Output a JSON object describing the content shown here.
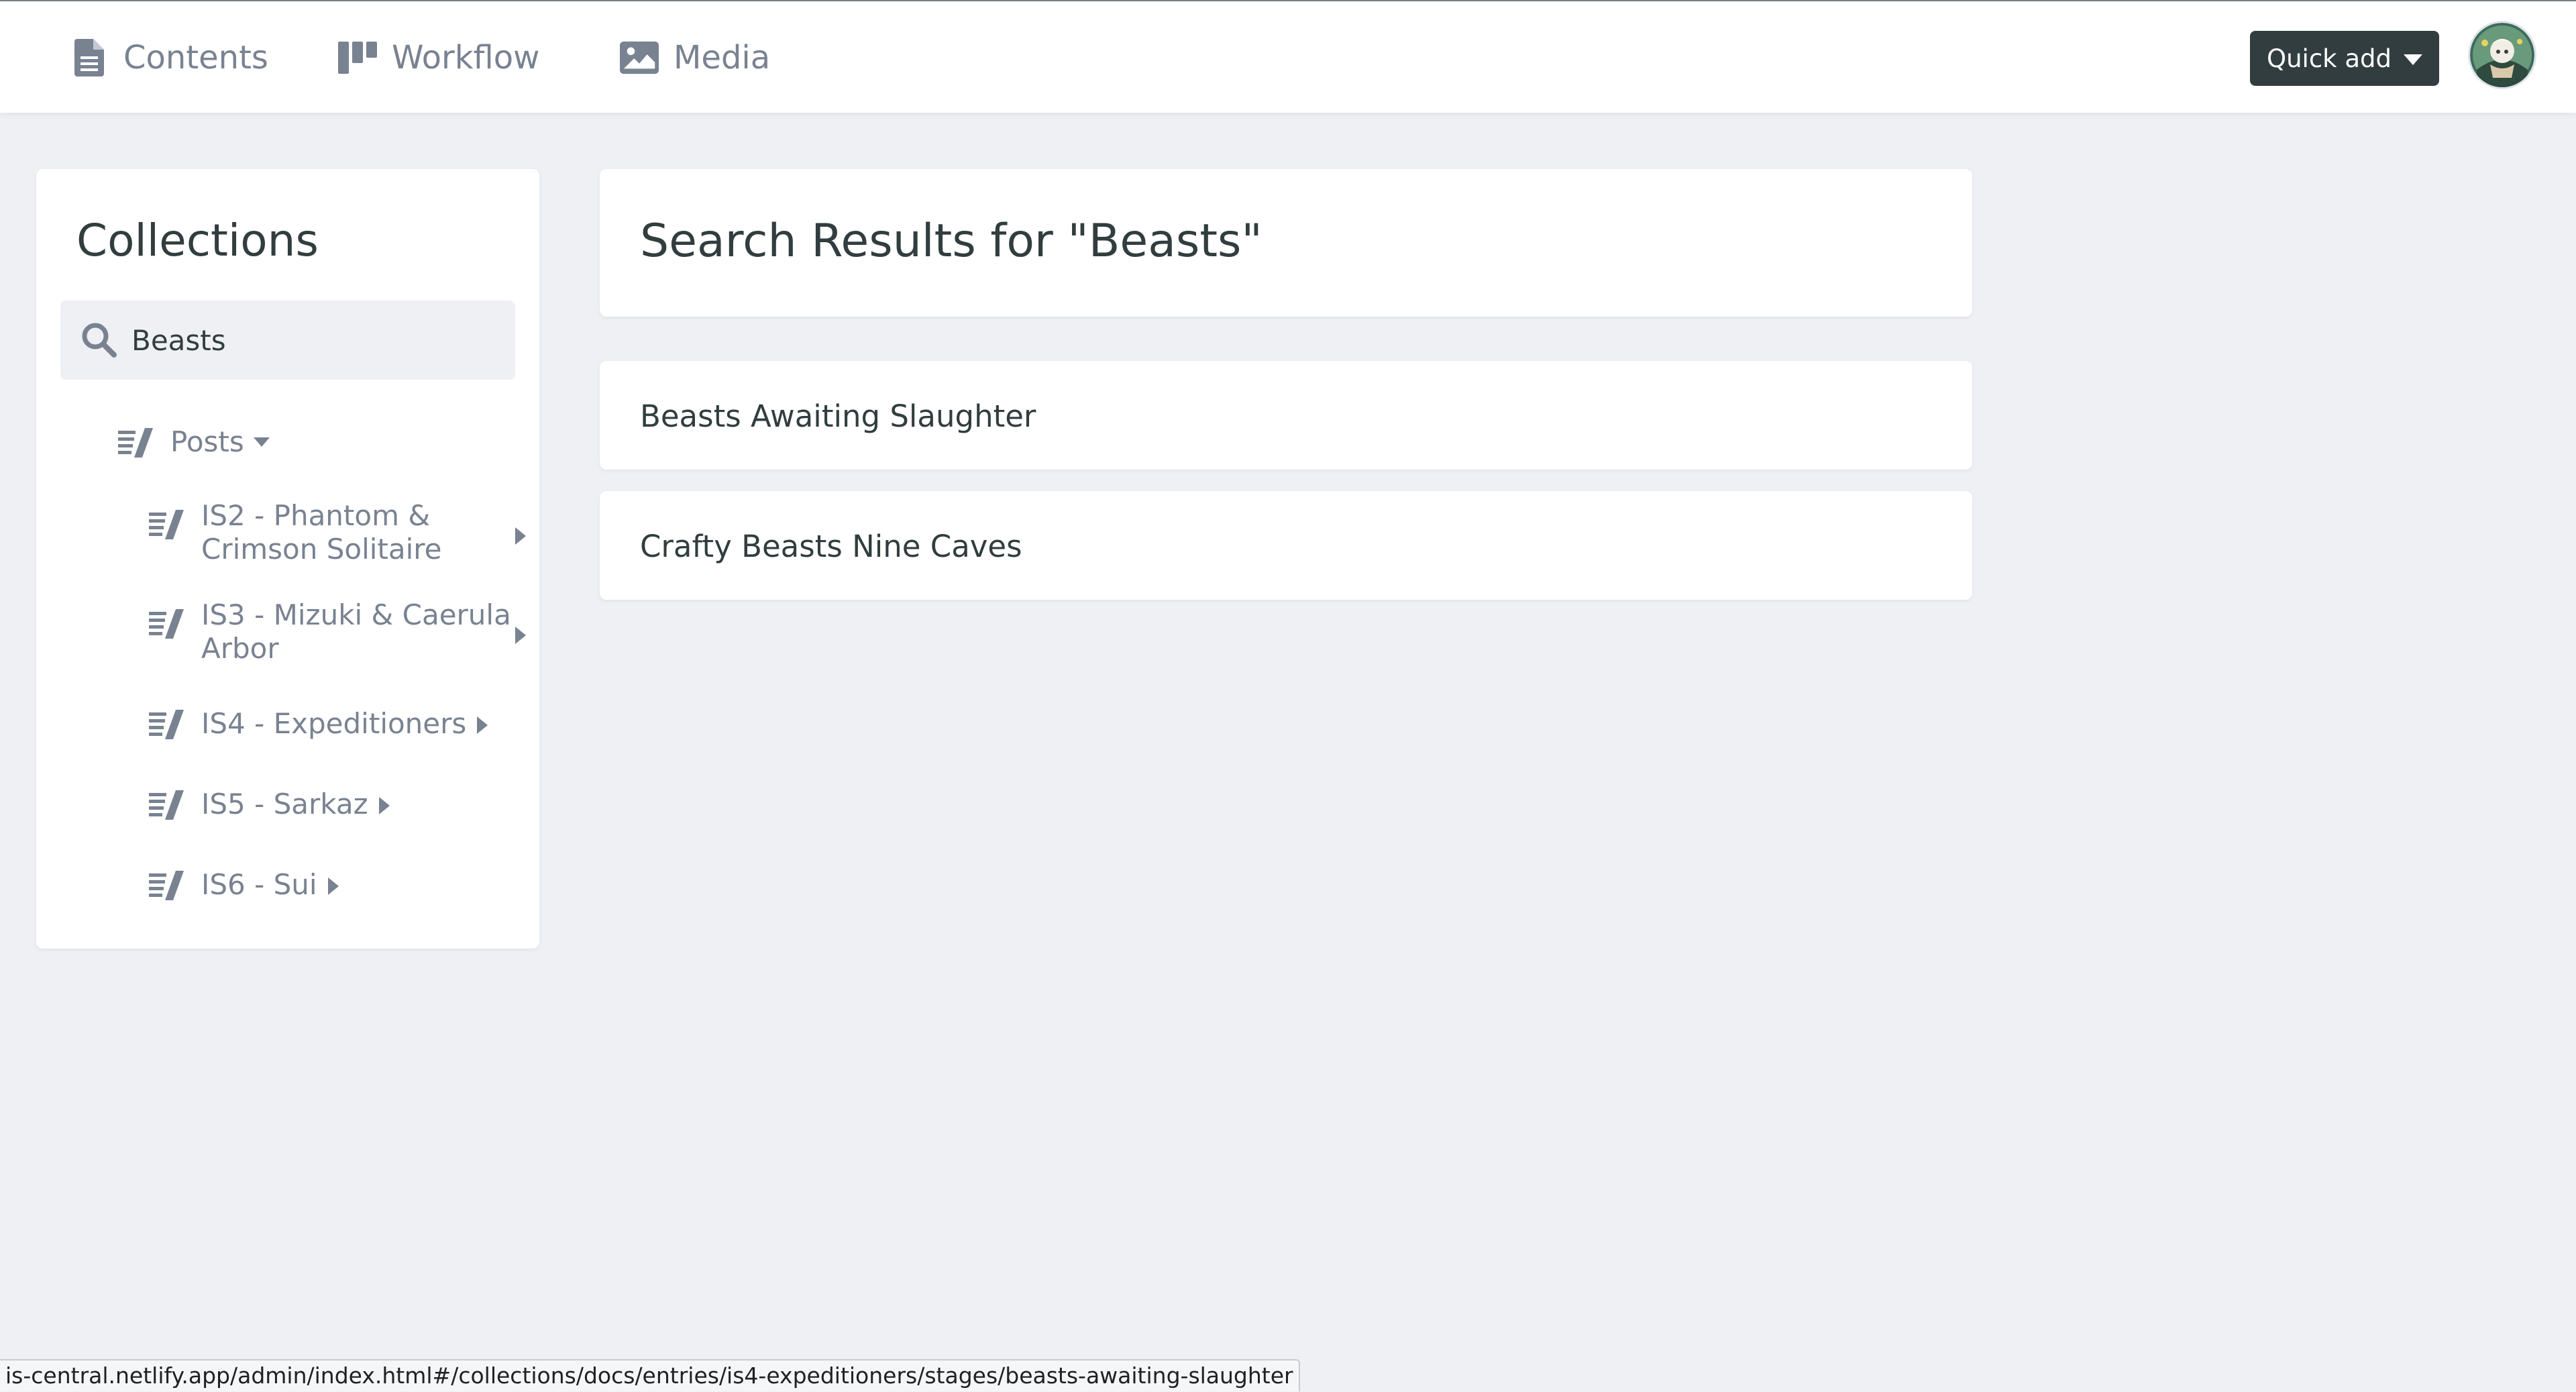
{
  "nav": {
    "items": [
      {
        "label": "Contents",
        "icon": "document-icon"
      },
      {
        "label": "Workflow",
        "icon": "kanban-icon"
      },
      {
        "label": "Media",
        "icon": "image-icon"
      }
    ],
    "quick_add_label": "Quick add"
  },
  "sidebar": {
    "title": "Collections",
    "search_value": "Beasts",
    "tree": {
      "posts": {
        "label": "Posts"
      },
      "children": [
        {
          "label": "IS2 - Phantom & Crimson Solitaire"
        },
        {
          "label": "IS3 - Mizuki & Caerula Arbor"
        },
        {
          "label": "IS4 - Expeditioners"
        },
        {
          "label": "IS5 - Sarkaz"
        },
        {
          "label": "IS6 - Sui"
        }
      ]
    }
  },
  "main": {
    "title": "Search Results for \"Beasts\"",
    "results": [
      {
        "label": "Beasts Awaiting Slaughter"
      },
      {
        "label": "Crafty Beasts Nine Caves"
      }
    ]
  },
  "status_bar": {
    "url": "is-central.netlify.app/admin/index.html#/collections/docs/entries/is4-expeditioners/stages/beasts-awaiting-slaughter"
  },
  "colors": {
    "background": "#eff0f4",
    "card": "#ffffff",
    "text_dark": "#313d3e",
    "text_muted": "#798291",
    "button_dark": "#313d3e"
  }
}
